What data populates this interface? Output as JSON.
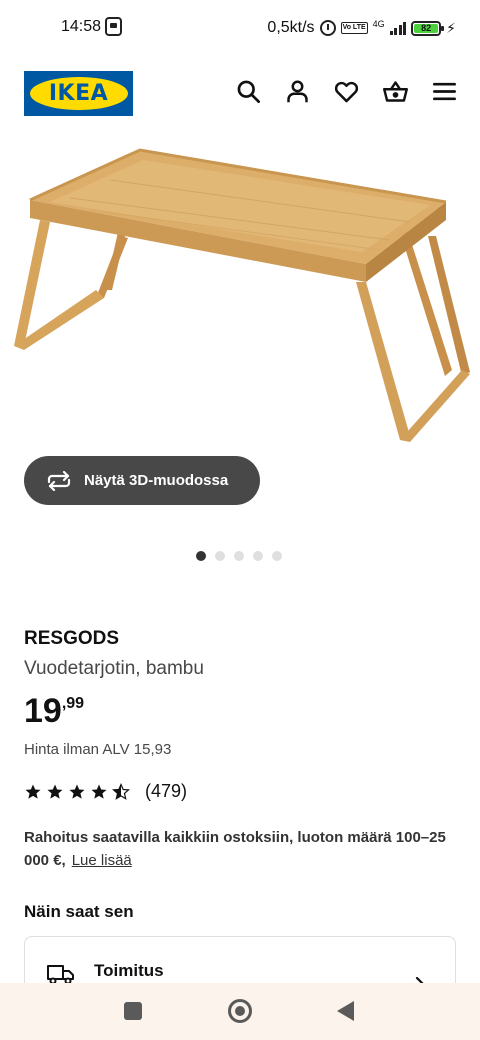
{
  "status_bar": {
    "time": "14:58",
    "network_speed": "0,5kt/s",
    "volte": "Vo LTE",
    "network_type": "4G",
    "battery_level": "82",
    "icons": [
      "notification-icon",
      "alarm-icon",
      "volte-icon",
      "signal-icon",
      "battery-icon",
      "charging-icon"
    ]
  },
  "header": {
    "logo_text": "IKEA",
    "icons": [
      "search-icon",
      "user-icon",
      "heart-icon",
      "basket-icon",
      "menu-icon"
    ]
  },
  "gallery": {
    "view_3d_label": "Näytä 3D-muodossa",
    "image_count": 5,
    "active_index": 0
  },
  "product": {
    "name": "RESGODS",
    "description": "Vuodetarjotin, bambu",
    "price_integer": "19",
    "price_decimal": ",99",
    "price_ex_vat": "Hinta ilman ALV 15,93",
    "rating_value": 4.5,
    "rating_max": 5,
    "review_count": "(479)"
  },
  "financing": {
    "text": "Rahoitus saatavilla kaikkiin ostoksiin, luoton määrä 100–25 000 €,",
    "link_label": "Lue lisää"
  },
  "availability": {
    "title": "Näin saat sen",
    "delivery_label": "Toimitus"
  },
  "colors": {
    "ikea_blue": "#0058a3",
    "ikea_yellow": "#ffdb00",
    "button_dark": "#484848",
    "battery_green": "#4cd13c",
    "nav_bar_bg": "#fbf3ec"
  }
}
